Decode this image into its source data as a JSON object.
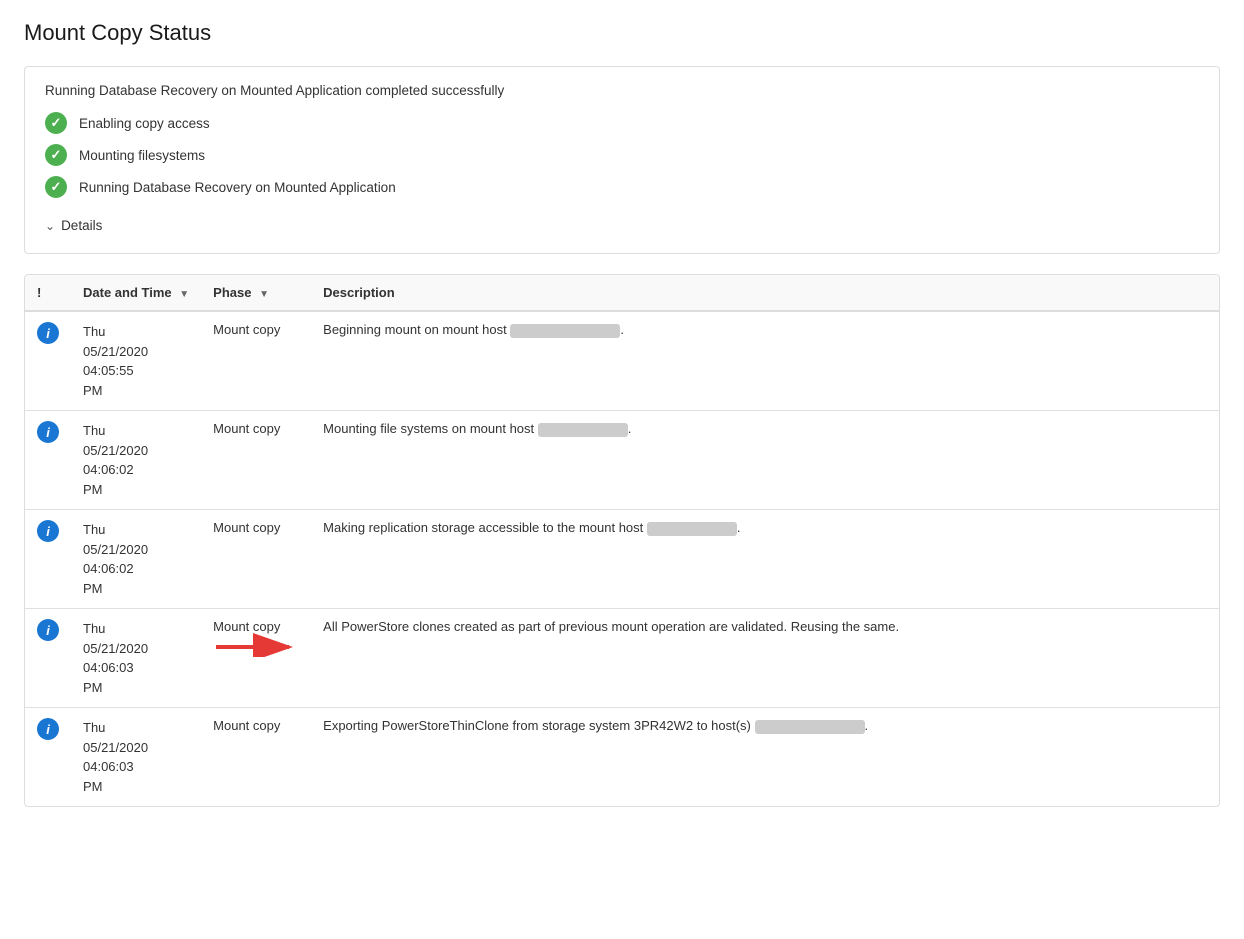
{
  "page": {
    "title": "Mount Copy Status"
  },
  "status_section": {
    "message": "Running Database Recovery on Mounted Application completed successfully",
    "items": [
      {
        "label": "Enabling copy access",
        "status": "success"
      },
      {
        "label": "Mounting filesystems",
        "status": "success"
      },
      {
        "label": "Running Database Recovery on Mounted Application",
        "status": "success"
      }
    ],
    "details_label": "Details"
  },
  "table": {
    "columns": [
      {
        "key": "icon",
        "label": "!",
        "sortable": false
      },
      {
        "key": "datetime",
        "label": "Date and Time",
        "sortable": true
      },
      {
        "key": "phase",
        "label": "Phase",
        "sortable": true
      },
      {
        "key": "description",
        "label": "Description",
        "sortable": false
      }
    ],
    "rows": [
      {
        "type": "info",
        "datetime": "Thu\n05/21/2020\n04:05:55\nPM",
        "phase": "Mount copy",
        "description": "Beginning mount on mount host",
        "has_redacted": true,
        "redacted_width": 110,
        "has_arrow": false
      },
      {
        "type": "info",
        "datetime": "Thu\n05/21/2020\n04:06:02\nPM",
        "phase": "Mount copy",
        "description": "Mounting file systems on mount host",
        "has_redacted": true,
        "redacted_width": 90,
        "has_arrow": false
      },
      {
        "type": "info",
        "datetime": "Thu\n05/21/2020\n04:06:02\nPM",
        "phase": "Mount copy",
        "description": "Making replication storage accessible to the mount host",
        "has_redacted": true,
        "redacted_width": 90,
        "has_arrow": false
      },
      {
        "type": "info",
        "datetime": "Thu\n05/21/2020\n04:06:03\nPM",
        "phase": "Mount copy",
        "description": "All PowerStore clones created as part of previous mount operation are validated. Reusing the same.",
        "has_redacted": false,
        "has_arrow": true
      },
      {
        "type": "info",
        "datetime": "Thu\n05/21/2020\n04:06:03\nPM",
        "phase": "Mount copy",
        "description": "Exporting PowerStoreThinClone from storage system 3PR42W2 to host(s)",
        "has_redacted": true,
        "redacted_width": 110,
        "has_arrow": false
      }
    ]
  }
}
